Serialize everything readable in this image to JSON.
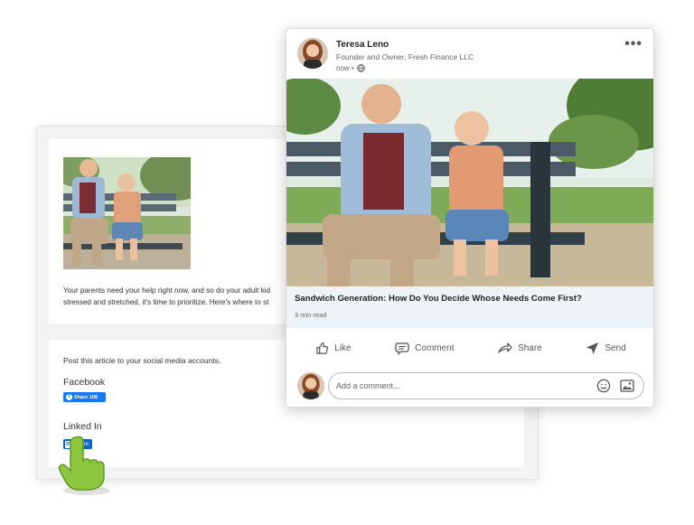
{
  "article": {
    "excerpt_line1": "Your parents need your help right now, and so do your adult kid",
    "excerpt_line2": "stressed and stretched, it's time to prioritize. Here's where to st"
  },
  "share": {
    "intro": "Post this article to your social media accounts.",
    "facebook_heading": "Facebook",
    "facebook_button": "Share 108",
    "facebook_icon": "facebook-icon",
    "linkedin_heading": "Linked In",
    "linkedin_button": "Share",
    "linkedin_icon": "linkedin-icon"
  },
  "post": {
    "author": "Teresa Leno",
    "headline": "Founder and Owner, Fresh Finance LLC",
    "time": "now •",
    "visibility_icon": "globe-icon",
    "more_icon": "more-options-icon",
    "more_label": "•••",
    "link_title": "Sandwich Generation: How Do You Decide Whose Needs Come First?",
    "link_meta": "3 min read",
    "actions": [
      {
        "label": "Like",
        "icon": "like-icon"
      },
      {
        "label": "Comment",
        "icon": "comment-icon"
      },
      {
        "label": "Share",
        "icon": "share-icon"
      },
      {
        "label": "Send",
        "icon": "send-icon"
      }
    ],
    "comment_placeholder": "Add a comment...",
    "emoji_icon": "emoji-icon",
    "image_icon": "image-icon"
  },
  "colors": {
    "facebook": "#1877f2",
    "linkedin": "#0a66c2",
    "link_box_bg": "#eef3f8",
    "hand_green": "#8dc63f"
  }
}
